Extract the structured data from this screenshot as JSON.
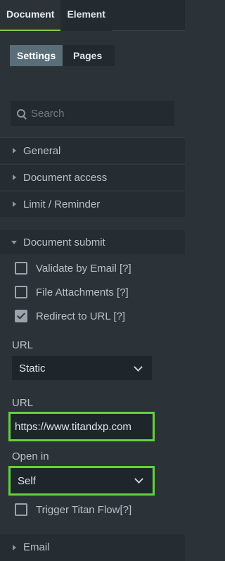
{
  "tabs": {
    "document": "Document",
    "element": "Element"
  },
  "subtabs": {
    "settings": "Settings",
    "pages": "Pages"
  },
  "search": {
    "placeholder": "Search"
  },
  "sections": {
    "general": "General",
    "document_access": "Document access",
    "limit_reminder": "Limit / Reminder",
    "document_submit": "Document submit",
    "email": "Email"
  },
  "document_submit": {
    "validate_by_email": {
      "label": "Validate by Email [?]",
      "checked": false
    },
    "file_attachments": {
      "label": "File Attachments [?]",
      "checked": false
    },
    "redirect_to_url": {
      "label": "Redirect to URL [?]",
      "checked": true
    },
    "url_type_label": "URL",
    "url_type_value": "Static",
    "url_label": "URL",
    "url_value": "https://www.titandxp.com",
    "open_in_label": "Open in",
    "open_in_value": "Self",
    "trigger_titan_flow": {
      "label": "Trigger Titan Flow[?]",
      "checked": false
    }
  },
  "colors": {
    "accent": "#8ac842",
    "highlight": "#63d23a",
    "background": "#2b3339"
  }
}
